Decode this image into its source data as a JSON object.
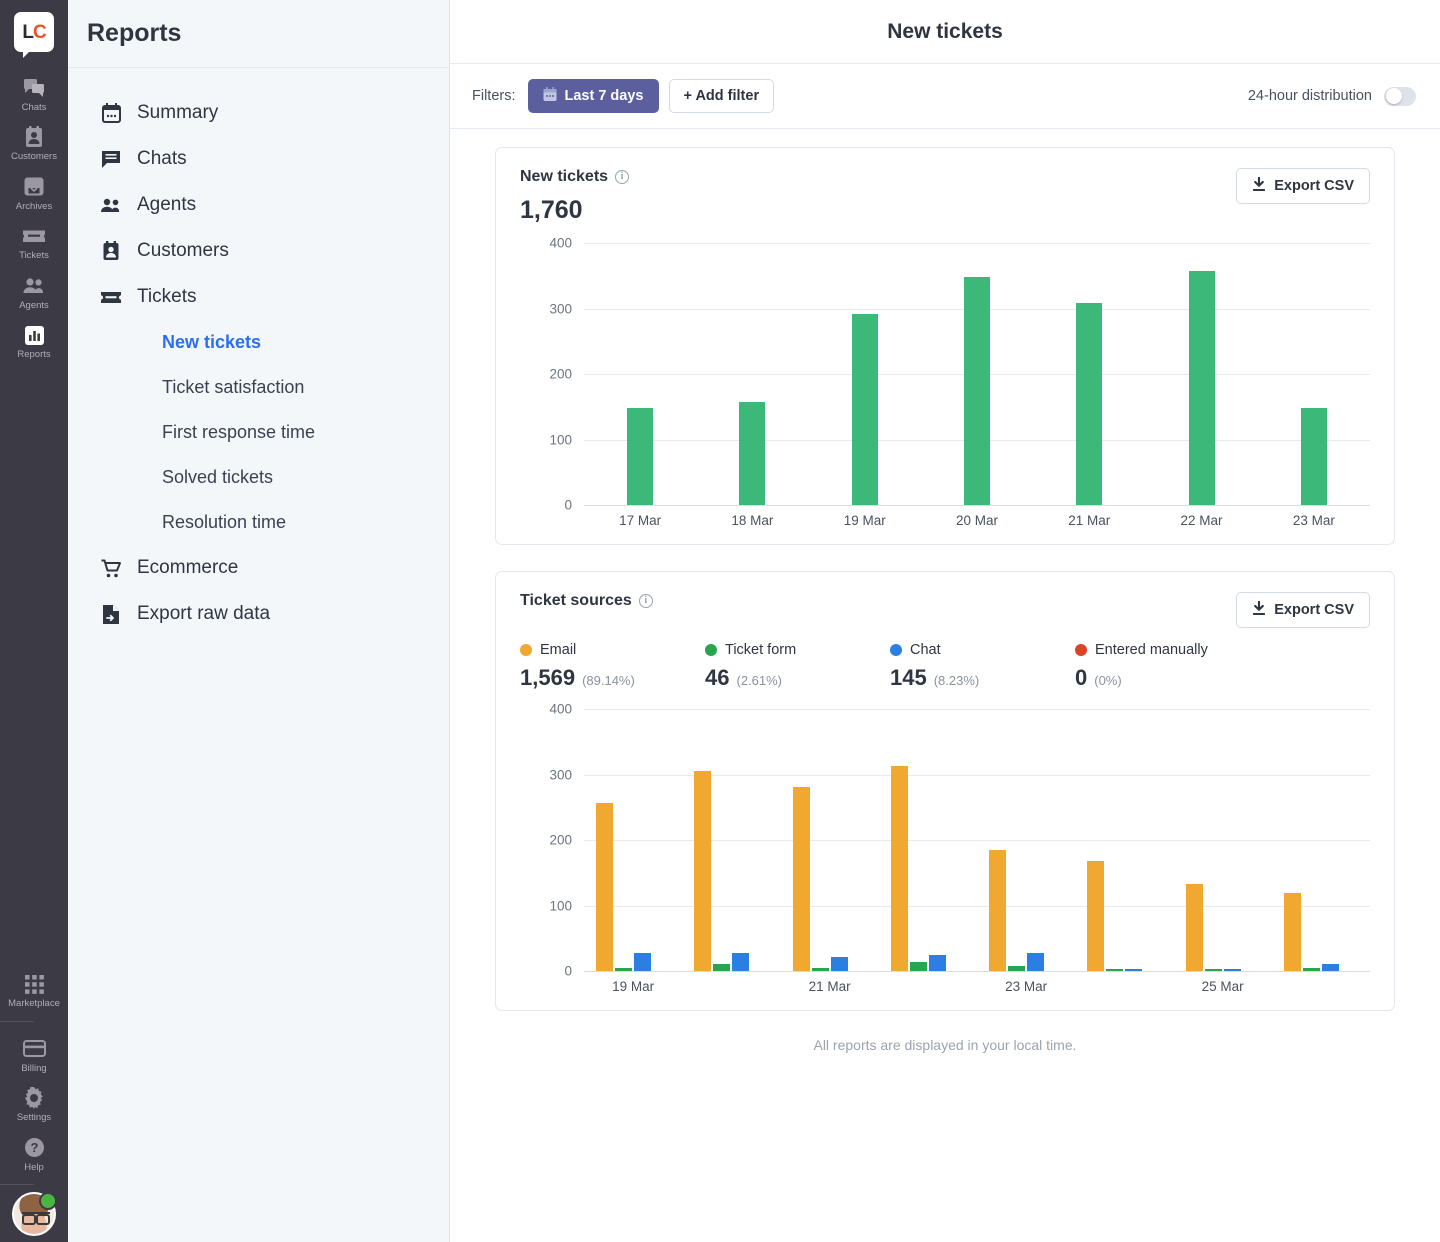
{
  "rail": {
    "logo": {
      "name": "livechat-logo",
      "text_left": "L",
      "text_right": "C"
    },
    "items": [
      {
        "label": "Chats",
        "icon": "chats-icon"
      },
      {
        "label": "Customers",
        "icon": "customers-icon"
      },
      {
        "label": "Archives",
        "icon": "archives-icon"
      },
      {
        "label": "Tickets",
        "icon": "tickets-icon"
      },
      {
        "label": "Agents",
        "icon": "agents-icon"
      },
      {
        "label": "Reports",
        "icon": "reports-icon"
      }
    ],
    "bottom_items": [
      {
        "label": "Marketplace",
        "icon": "marketplace-icon"
      },
      {
        "label": "Billing",
        "icon": "billing-icon"
      },
      {
        "label": "Settings",
        "icon": "gear-icon"
      },
      {
        "label": "Help",
        "icon": "help-icon"
      }
    ]
  },
  "nav": {
    "title": "Reports",
    "items": [
      {
        "label": "Summary",
        "icon": "calendar-icon"
      },
      {
        "label": "Chats",
        "icon": "chat-bubble-icon"
      },
      {
        "label": "Agents",
        "icon": "agents-icon"
      },
      {
        "label": "Customers",
        "icon": "customer-card-icon"
      },
      {
        "label": "Tickets",
        "icon": "ticket-icon"
      }
    ],
    "sub_items": [
      {
        "label": "New tickets",
        "active": true
      },
      {
        "label": "Ticket satisfaction",
        "active": false
      },
      {
        "label": "First response time",
        "active": false
      },
      {
        "label": "Solved tickets",
        "active": false
      },
      {
        "label": "Resolution time",
        "active": false
      }
    ],
    "items_after": [
      {
        "label": "Ecommerce",
        "icon": "cart-icon"
      },
      {
        "label": "Export raw data",
        "icon": "export-file-icon"
      }
    ]
  },
  "header": {
    "title": "New tickets"
  },
  "filterbar": {
    "label": "Filters:",
    "date_chip": "Last 7 days",
    "add_filter": "+ Add filter",
    "toggle_label": "24-hour distribution",
    "toggle_on": false
  },
  "cards": {
    "new_tickets": {
      "title": "New tickets",
      "total": "1,760",
      "export_label": "Export CSV"
    },
    "ticket_sources": {
      "title": "Ticket sources",
      "export_label": "Export CSV",
      "legend": [
        {
          "name": "Email",
          "value": "1,569",
          "percent": "(89.14%)",
          "color": "#f0a831"
        },
        {
          "name": "Ticket form",
          "value": "46",
          "percent": "(2.61%)",
          "color": "#2aa44f"
        },
        {
          "name": "Chat",
          "value": "145",
          "percent": "(8.23%)",
          "color": "#2a7fe0"
        },
        {
          "name": "Entered manually",
          "value": "0",
          "percent": "(0%)",
          "color": "#db4327"
        }
      ]
    }
  },
  "footnote": "All reports are displayed in your local time.",
  "chart_data": [
    {
      "type": "bar",
      "title": "New tickets",
      "xlabel": "",
      "ylabel": "",
      "ylim": [
        0,
        400
      ],
      "yticks": [
        0,
        100,
        200,
        300,
        400
      ],
      "grid": true,
      "legend_position": "none",
      "bar_color": "#3cb878",
      "categories": [
        "17 Mar",
        "18 Mar",
        "19 Mar",
        "20 Mar",
        "21 Mar",
        "22 Mar",
        "23 Mar"
      ],
      "values": [
        148,
        158,
        291,
        348,
        308,
        357,
        148
      ]
    },
    {
      "type": "bar",
      "title": "Ticket sources",
      "xlabel": "",
      "ylabel": "",
      "ylim": [
        0,
        400
      ],
      "yticks": [
        0,
        100,
        200,
        300,
        400
      ],
      "grid": true,
      "legend_position": "top",
      "categories": [
        "19 Mar",
        "20 Mar",
        "21 Mar",
        "22 Mar",
        "23 Mar",
        "24 Mar",
        "25 Mar",
        "26 Mar"
      ],
      "tick_labels": [
        "19 Mar",
        "",
        "21 Mar",
        "",
        "23 Mar",
        "",
        "25 Mar",
        ""
      ],
      "series": [
        {
          "name": "Email",
          "color": "#f0a831",
          "values": [
            256,
            306,
            281,
            313,
            185,
            168,
            133,
            119
          ]
        },
        {
          "name": "Ticket form",
          "color": "#2aa44f",
          "values": [
            5,
            10,
            5,
            14,
            8,
            3,
            3,
            4
          ]
        },
        {
          "name": "Chat",
          "color": "#2a7fe0",
          "values": [
            28,
            27,
            22,
            24,
            28,
            3,
            3,
            10
          ]
        },
        {
          "name": "Entered manually",
          "color": "#db4327",
          "values": [
            0,
            0,
            0,
            0,
            0,
            0,
            0,
            0
          ]
        }
      ]
    }
  ]
}
